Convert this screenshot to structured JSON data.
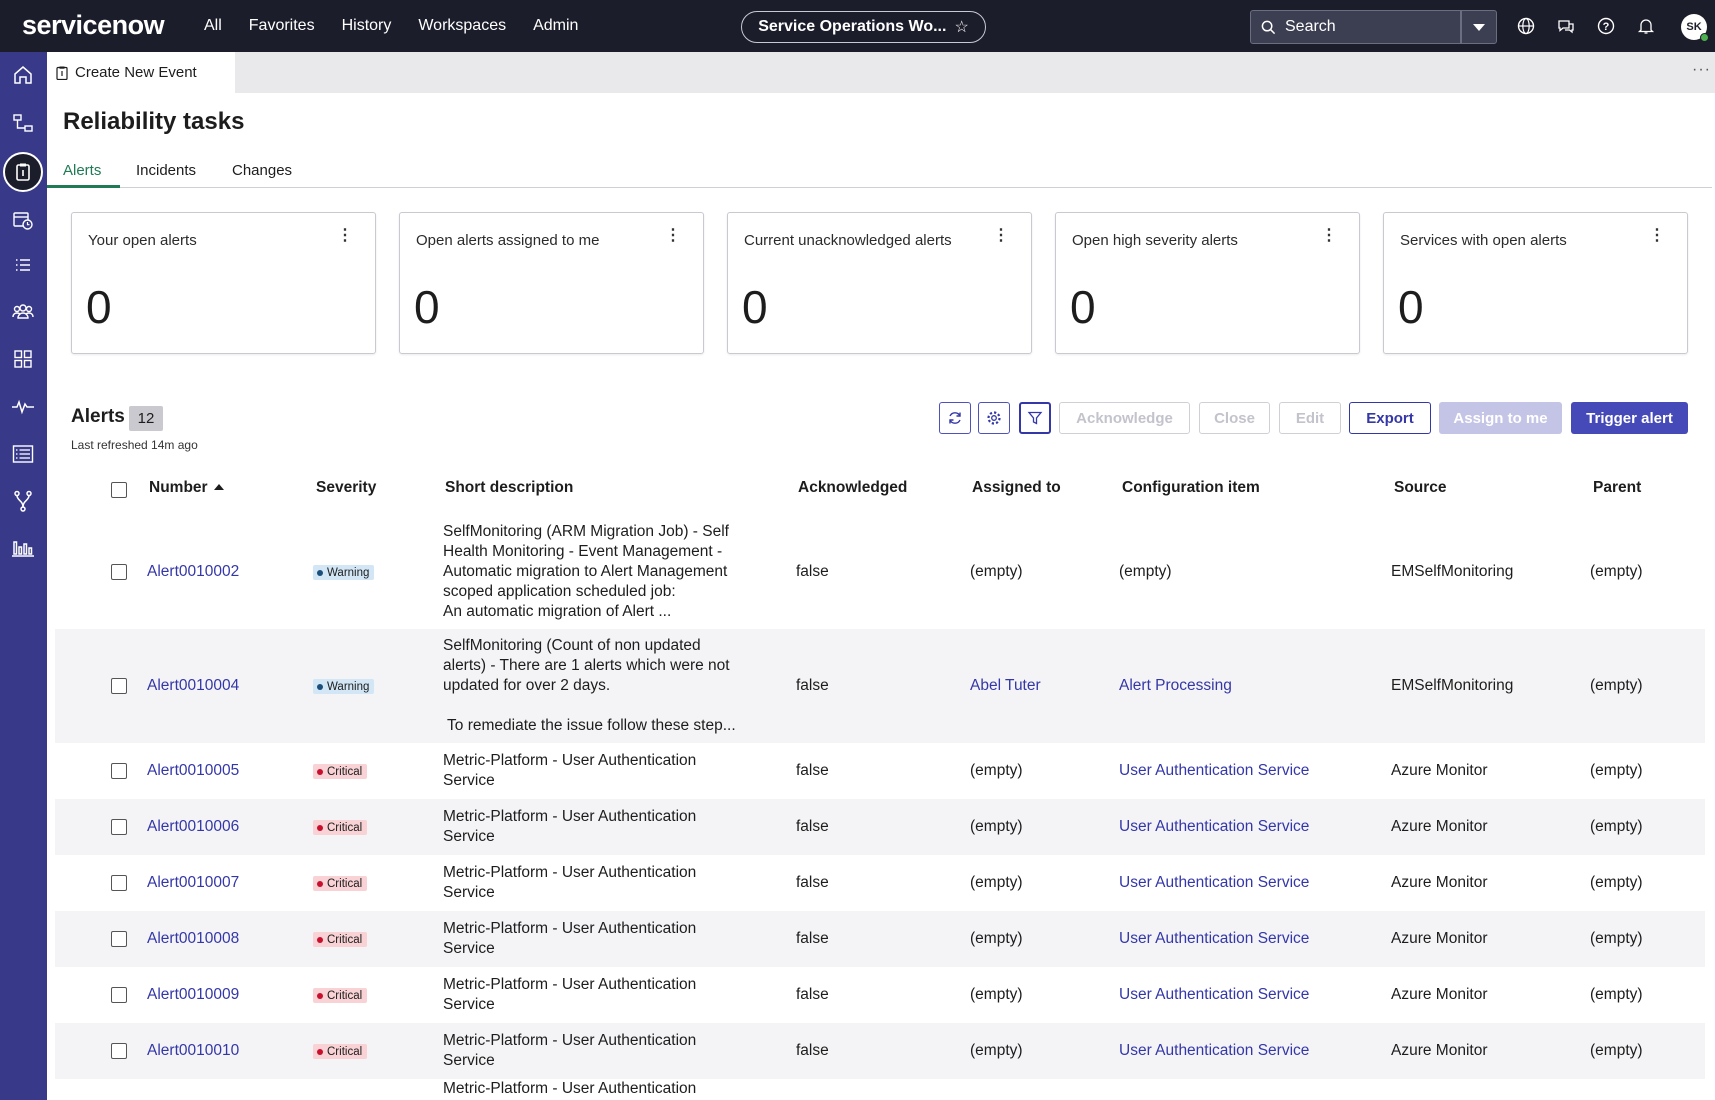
{
  "topnav": {
    "logo": "servicenow",
    "links": [
      "All",
      "Favorites",
      "History",
      "Workspaces",
      "Admin"
    ],
    "workspace": "Service Operations Wo...",
    "search_placeholder": "Search",
    "avatar_initials": "SK"
  },
  "tab": {
    "label": "Create New Event"
  },
  "page": {
    "title": "Reliability tasks"
  },
  "subtabs": [
    "Alerts",
    "Incidents",
    "Changes"
  ],
  "cards": [
    {
      "title": "Your open alerts",
      "value": "0"
    },
    {
      "title": "Open alerts assigned to me",
      "value": "0"
    },
    {
      "title": "Current unacknowledged alerts",
      "value": "0"
    },
    {
      "title": "Open high severity alerts",
      "value": "0"
    },
    {
      "title": "Services with open alerts",
      "value": "0"
    }
  ],
  "alerts": {
    "heading": "Alerts",
    "count": "12",
    "last_refreshed": "Last refreshed 14m ago",
    "buttons": {
      "acknowledge": "Acknowledge",
      "close": "Close",
      "edit": "Edit",
      "export": "Export",
      "assign": "Assign to me",
      "trigger": "Trigger alert"
    }
  },
  "table": {
    "columns": [
      "Number",
      "Severity",
      "Short description",
      "Acknowledged",
      "Assigned to",
      "Configuration item",
      "Source",
      "Parent"
    ],
    "rows": [
      {
        "number": "Alert0010002",
        "severity": "Warning",
        "description": [
          "SelfMonitoring (ARM Migration Job) - Self",
          "Health Monitoring - Event Management -",
          "Automatic migration to Alert Management",
          "scoped application scheduled job:",
          "An automatic migration of Alert ..."
        ],
        "acknowledged": "false",
        "assigned": "(empty)",
        "ci": "(empty)",
        "source": "EMSelfMonitoring",
        "parent": "(empty)"
      },
      {
        "number": "Alert0010004",
        "severity": "Warning",
        "description": [
          "SelfMonitoring (Count of non updated",
          "alerts) - There are 1 alerts which were not",
          "updated for over 2 days.",
          "",
          " To remediate the issue follow these step..."
        ],
        "acknowledged": "false",
        "assigned": "Abel Tuter",
        "ci": "Alert Processing",
        "source": "EMSelfMonitoring",
        "parent": "(empty)"
      },
      {
        "number": "Alert0010005",
        "severity": "Critical",
        "description": [
          "Metric-Platform - User Authentication",
          "Service"
        ],
        "acknowledged": "false",
        "assigned": "(empty)",
        "ci": "User Authentication Service",
        "source": "Azure Monitor",
        "parent": "(empty)"
      },
      {
        "number": "Alert0010006",
        "severity": "Critical",
        "description": [
          "Metric-Platform - User Authentication",
          "Service"
        ],
        "acknowledged": "false",
        "assigned": "(empty)",
        "ci": "User Authentication Service",
        "source": "Azure Monitor",
        "parent": "(empty)"
      },
      {
        "number": "Alert0010007",
        "severity": "Critical",
        "description": [
          "Metric-Platform - User Authentication",
          "Service"
        ],
        "acknowledged": "false",
        "assigned": "(empty)",
        "ci": "User Authentication Service",
        "source": "Azure Monitor",
        "parent": "(empty)"
      },
      {
        "number": "Alert0010008",
        "severity": "Critical",
        "description": [
          "Metric-Platform - User Authentication",
          "Service"
        ],
        "acknowledged": "false",
        "assigned": "(empty)",
        "ci": "User Authentication Service",
        "source": "Azure Monitor",
        "parent": "(empty)"
      },
      {
        "number": "Alert0010009",
        "severity": "Critical",
        "description": [
          "Metric-Platform - User Authentication",
          "Service"
        ],
        "acknowledged": "false",
        "assigned": "(empty)",
        "ci": "User Authentication Service",
        "source": "Azure Monitor",
        "parent": "(empty)"
      },
      {
        "number": "Alert0010010",
        "severity": "Critical",
        "description": [
          "Metric-Platform - User Authentication",
          "Service"
        ],
        "acknowledged": "false",
        "assigned": "(empty)",
        "ci": "User Authentication Service",
        "source": "Azure Monitor",
        "parent": "(empty)"
      },
      {
        "number": "",
        "severity": "",
        "description": [
          "Metric-Platform - User Authentication"
        ],
        "acknowledged": "",
        "assigned": "",
        "ci": "",
        "source": "",
        "parent": ""
      }
    ]
  },
  "colors": {
    "topnav_bg": "#1c1d2a",
    "sidenav_bg": "#39398a",
    "link": "#3437a8",
    "primary": "#4649b8",
    "active_tab": "#1f7a55",
    "warning_badge": "#d2e6f5",
    "critical_badge": "#f8d2d4"
  },
  "icons": {
    "sidenav": [
      "home-icon",
      "flow-icon",
      "clipboard-icon",
      "calendar-clock-icon",
      "list-icon",
      "people-icon",
      "grid-icon",
      "pulse-icon",
      "form-list-icon",
      "branch-icon",
      "chart-icon"
    ],
    "topnav": [
      "globe-icon",
      "chat-icon",
      "help-icon",
      "bell-icon"
    ]
  }
}
